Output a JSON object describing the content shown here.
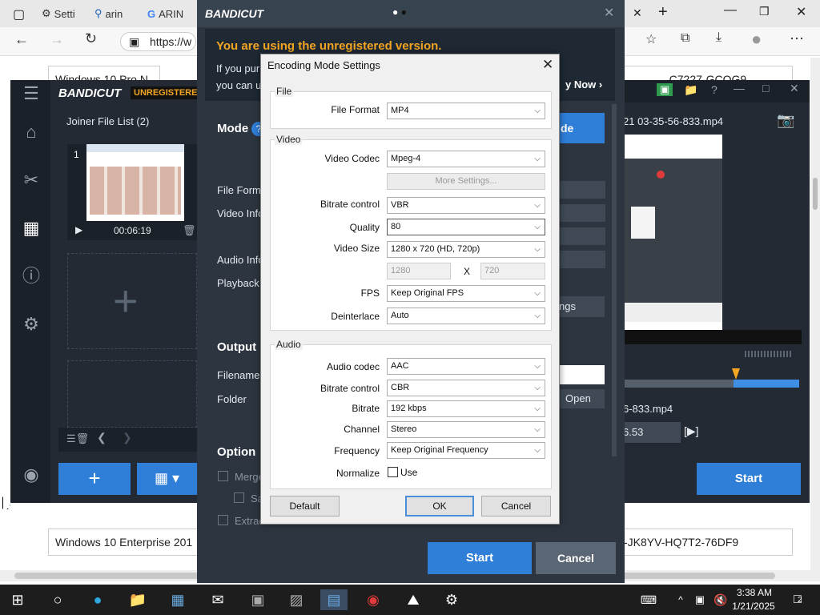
{
  "browser": {
    "tabs": [
      {
        "label": "Setti"
      },
      {
        "label": "arin"
      },
      {
        "label": "ARIN"
      }
    ],
    "url_prefix": "https://w",
    "page_rows": [
      {
        "text": "Windows 10 Pro N"
      },
      {
        "text": "-C7227-GCQG9"
      },
      {
        "text": "Windows 10 Enterprise 201"
      },
      {
        "text": "-JK8YV-HQ7T2-76DF9"
      }
    ]
  },
  "bandicut_left": {
    "logo": "BANDICUT",
    "badge": "UNREGISTERED",
    "joiner_title": "Joiner File List (2)",
    "clip_index": "1",
    "clip_duration": "00:06:19"
  },
  "bandicut_main": {
    "logo": "BANDICUT",
    "unregistered_msg": "You are using the unregistered version.",
    "line1": "If you pur",
    "line2": "you can u",
    "buy_now": "y Now ›",
    "mode_label": "Mode",
    "mode_btn": "de",
    "file_format": "File Forma",
    "video_info": "Video Info",
    "audio_info": "Audio Info",
    "playback": "Playback s",
    "settings_btn": "ngs",
    "output_label": "Output",
    "filename_label": "Filename",
    "folder_label": "Folder",
    "open_btn": "Open",
    "option_label": "Option",
    "opt_merge": "Merge",
    "opt_sa": "Sa",
    "opt_extract": "Extrac",
    "start_btn": "Start",
    "cancel_btn": "Cancel"
  },
  "bandicut_right": {
    "filename_top": "21 03-35-56-833.mp4",
    "filename_bottom": "6-833.mp4",
    "time": "6.53",
    "start_btn": "Start"
  },
  "dialog": {
    "title": "Encoding Mode Settings",
    "file_group": "File",
    "file_format_label": "File Format",
    "file_format_value": "MP4",
    "video_group": "Video",
    "video_codec_label": "Video Codec",
    "video_codec_value": "Mpeg-4",
    "more_settings": "More Settings...",
    "bitrate_control_label": "Bitrate control",
    "bitrate_control_value": "VBR",
    "quality_label": "Quality",
    "quality_value": "80",
    "video_size_label": "Video Size",
    "video_size_value": "1280 x 720 (HD, 720p)",
    "width_value": "1280",
    "x_label": "X",
    "height_value": "720",
    "fps_label": "FPS",
    "fps_value": "Keep Original FPS",
    "deinterlace_label": "Deinterlace",
    "deinterlace_value": "Auto",
    "audio_group": "Audio",
    "audio_codec_label": "Audio codec",
    "audio_codec_value": "AAC",
    "a_bitrate_control_label": "Bitrate control",
    "a_bitrate_control_value": "CBR",
    "bitrate_label": "Bitrate",
    "bitrate_value": "192 kbps",
    "channel_label": "Channel",
    "channel_value": "Stereo",
    "frequency_label": "Frequency",
    "frequency_value": "Keep Original Frequency",
    "normalize_label": "Normalize",
    "use_label": "Use",
    "default_btn": "Default",
    "ok_btn": "OK",
    "cancel_btn": "Cancel"
  },
  "taskbar": {
    "time": "3:38 AM",
    "date": "1/21/2025",
    "notif_count": "2"
  },
  "colors": {
    "accent_orange": "#f5a623",
    "bandi_blue": "#2f7ed8",
    "dialog_bg": "#f0f0f0"
  }
}
